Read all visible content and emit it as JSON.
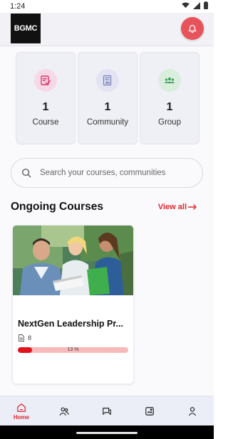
{
  "status_bar": {
    "time": "1:24"
  },
  "header": {
    "logo_text": "BGMC"
  },
  "stats": [
    {
      "count": "1",
      "label": "Course",
      "icon": "course-icon",
      "color": "#d63a6a",
      "bg": "#f7d9e6"
    },
    {
      "count": "1",
      "label": "Community",
      "icon": "community-icon",
      "color": "#7a82b8",
      "bg": "#e2e4f4"
    },
    {
      "count": "1",
      "label": "Group",
      "icon": "group-icon",
      "color": "#3a9a58",
      "bg": "#d9eedd"
    }
  ],
  "search": {
    "placeholder": "Search your courses, communities",
    "value": ""
  },
  "ongoing": {
    "title": "Ongoing Courses",
    "view_all": "View all",
    "courses": [
      {
        "title": "NextGen Leadership Pr...",
        "lessons": "8",
        "progress_text": "13 %",
        "progress": 0.13
      }
    ]
  },
  "nav": {
    "home_label": "Home"
  },
  "colors": {
    "accent": "#e0262a",
    "bell": "#e8525a"
  }
}
